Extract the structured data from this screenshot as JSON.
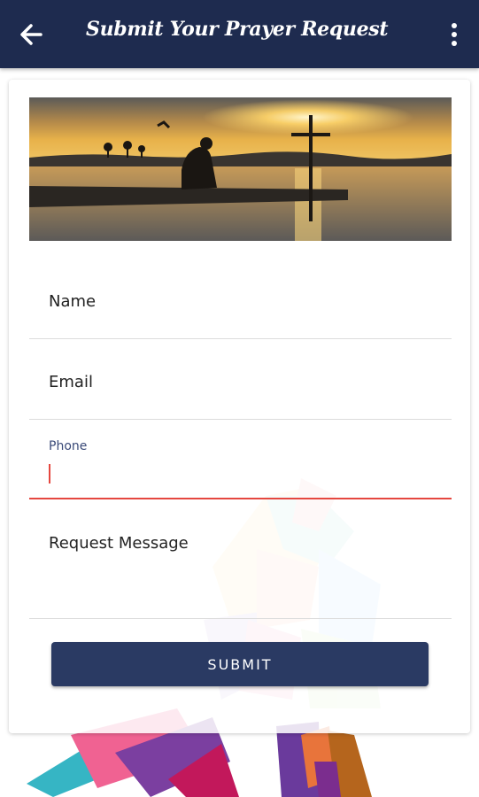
{
  "appbar": {
    "title": "Submit Your Prayer Request",
    "back_icon": "arrow-back-icon",
    "menu_icon": "more-vert-icon",
    "background_color": "#1e2b4f"
  },
  "banner": {
    "image": "kneeling-figure-cross-sunset-photo"
  },
  "form": {
    "name_label": "Name",
    "email_label": "Email",
    "phone_label": "Phone",
    "phone_value": "",
    "message_label": "Request Message",
    "submit_label": "SUBMIT",
    "focus_color": "#e5473f",
    "button_color": "#2a3a63"
  }
}
